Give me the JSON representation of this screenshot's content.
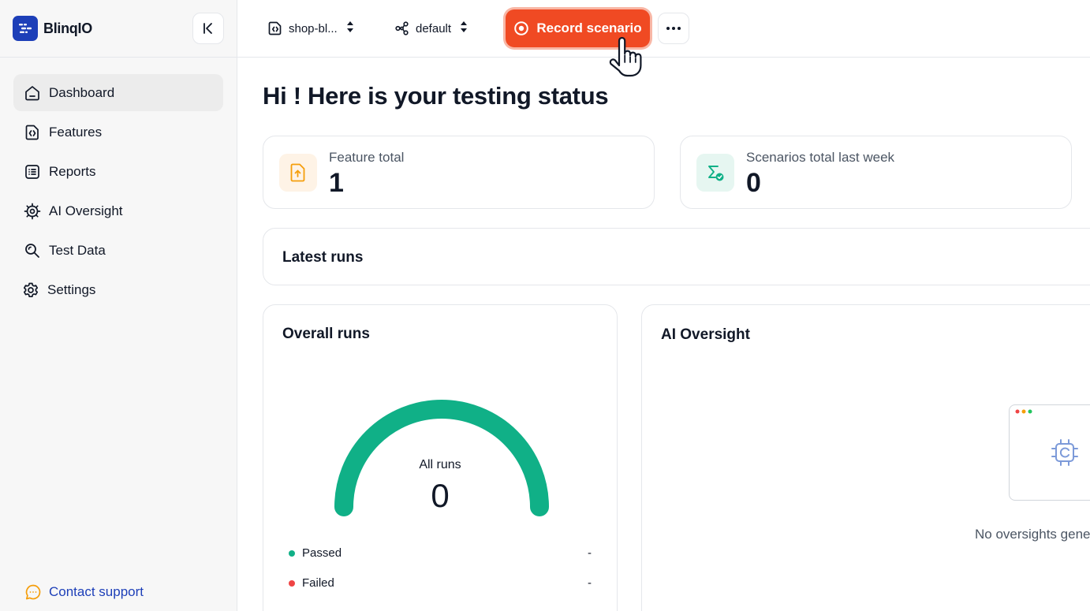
{
  "app": {
    "name": "BlinqIO"
  },
  "sidebar": {
    "items": [
      {
        "label": "Dashboard",
        "icon": "home-icon",
        "active": true
      },
      {
        "label": "Features",
        "icon": "feature-file-icon",
        "active": false
      },
      {
        "label": "Reports",
        "icon": "reports-list-icon",
        "active": false
      },
      {
        "label": "AI Oversight",
        "icon": "ai-chip-icon",
        "active": false
      },
      {
        "label": "Test Data",
        "icon": "search-data-icon",
        "active": false
      },
      {
        "label": "Settings",
        "icon": "gear-icon",
        "active": false
      }
    ],
    "contact_label": "Contact support"
  },
  "topbar": {
    "project": "shop-bl...",
    "environment": "default",
    "record_label": "Record scenario"
  },
  "main": {
    "greeting": "Hi ! Here is your testing status",
    "stats": {
      "feature_total_label": "Feature total",
      "feature_total_value": "1",
      "scenarios_label": "Scenarios total last week",
      "scenarios_value": "0"
    },
    "latest_runs_title": "Latest runs",
    "overall": {
      "title": "Overall runs",
      "gauge_label": "All runs",
      "gauge_value": "0",
      "passed_label": "Passed",
      "passed_value": "-",
      "failed_label": "Failed",
      "failed_value": "-"
    },
    "oversight": {
      "title": "AI Oversight",
      "empty_text": "No oversights gene"
    }
  },
  "colors": {
    "brand": "#1d3fb8",
    "record": "#f04a23",
    "passed": "#10b087",
    "failed": "#ef4444",
    "feature_icon_bg": "#fef3e6",
    "scenario_icon_bg": "#e6f6f1"
  }
}
